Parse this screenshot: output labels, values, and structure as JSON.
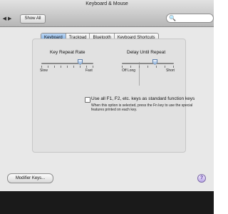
{
  "window": {
    "title": "Keyboard & Mouse"
  },
  "toolbar": {
    "back_forward_icon": "◀ ▶",
    "show_all_label": "Show All",
    "search_icon": "🔍",
    "search_value": ""
  },
  "tabs": [
    {
      "label": "Keyboard",
      "active": true
    },
    {
      "label": "Trackpad",
      "active": false
    },
    {
      "label": "Bluetooth",
      "active": false
    },
    {
      "label": "Keyboard Shortcuts",
      "active": false
    }
  ],
  "keyboard": {
    "key_repeat": {
      "title": "Key Repeat Rate",
      "min_label": "Slow",
      "max_label": "Fast"
    },
    "delay_until_repeat": {
      "title": "Delay Until Repeat",
      "min_label": "Off Long",
      "max_label": "Short"
    },
    "function_keys": {
      "label": "Use all F1, F2, etc. keys as standard function keys",
      "help": "When this option is selected, press the Fn key to use the special features printed on each key."
    }
  },
  "footer": {
    "modifier_keys_label": "Modifier Keys...",
    "help_icon": "?"
  },
  "colors": {
    "accent": "#6ea3dd",
    "window_bg": "#e8e8e8",
    "dark_bg": "#1a1a1a"
  }
}
